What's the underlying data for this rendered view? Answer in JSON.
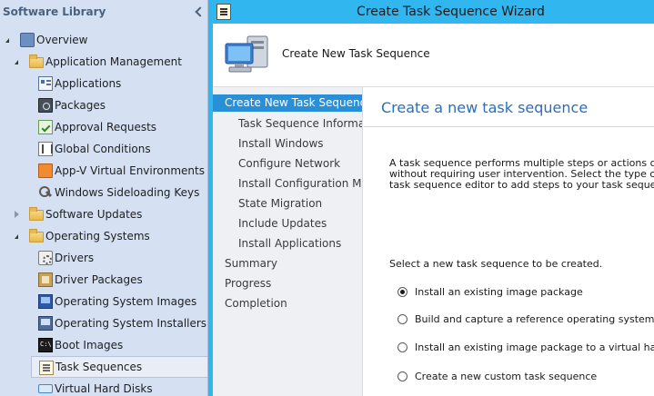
{
  "nav": {
    "header": "Software Library",
    "tree": [
      {
        "label": "Overview",
        "icon": "overview-icon",
        "level": 0,
        "expander": "open"
      },
      {
        "label": "Application Management",
        "icon": "folder-icon",
        "level": 1,
        "expander": "open"
      },
      {
        "label": "Applications",
        "icon": "applications-icon",
        "level": 2
      },
      {
        "label": "Packages",
        "icon": "packages-icon",
        "level": 2
      },
      {
        "label": "Approval Requests",
        "icon": "approval-requests-icon",
        "level": 2
      },
      {
        "label": "Global Conditions",
        "icon": "global-conditions-icon",
        "level": 2
      },
      {
        "label": "App-V Virtual Environments",
        "icon": "appv-icon",
        "level": 2
      },
      {
        "label": "Windows Sideloading Keys",
        "icon": "sideloading-keys-icon",
        "level": 2
      },
      {
        "label": "Software Updates",
        "icon": "folder-icon",
        "level": 1,
        "expander": "closed"
      },
      {
        "label": "Operating Systems",
        "icon": "folder-icon",
        "level": 1,
        "expander": "open"
      },
      {
        "label": "Drivers",
        "icon": "drivers-icon",
        "level": 2
      },
      {
        "label": "Driver Packages",
        "icon": "driver-packages-icon",
        "level": 2
      },
      {
        "label": "Operating System Images",
        "icon": "os-images-icon",
        "level": 2
      },
      {
        "label": "Operating System Installers",
        "icon": "os-installers-icon",
        "level": 2
      },
      {
        "label": "Boot Images",
        "icon": "boot-images-icon",
        "level": 2
      },
      {
        "label": "Task Sequences",
        "icon": "task-sequences-icon",
        "level": 2,
        "selected": true
      },
      {
        "label": "Virtual Hard Disks",
        "icon": "virtual-hard-disks-icon",
        "level": 2
      }
    ]
  },
  "wizard": {
    "title": "Create Task Sequence Wizard",
    "banner_title": "Create New Task Sequence",
    "steps": [
      {
        "label": "Create New Task Sequence",
        "indent": 0,
        "active": true
      },
      {
        "label": "Task Sequence Information",
        "indent": 1
      },
      {
        "label": "Install Windows",
        "indent": 1
      },
      {
        "label": "Configure Network",
        "indent": 1
      },
      {
        "label": "Install Configuration Manager",
        "indent": 1
      },
      {
        "label": "State Migration",
        "indent": 1
      },
      {
        "label": "Include Updates",
        "indent": 1
      },
      {
        "label": "Install Applications",
        "indent": 1
      },
      {
        "label": "Summary",
        "indent": 0
      },
      {
        "label": "Progress",
        "indent": 0
      },
      {
        "label": "Completion",
        "indent": 0
      }
    ],
    "content": {
      "title": "Create a new task sequence",
      "description_lines": [
        "A task sequence performs multiple steps or actions on a client computer",
        "without requiring user intervention. Select the type of task sequence. Use the",
        "task sequence editor to add steps to your task sequence."
      ],
      "select_prompt": "Select a new task sequence to be created.",
      "options": [
        {
          "label": "Install an existing image package",
          "checked": true
        },
        {
          "label": "Build and capture a reference operating system image",
          "checked": false
        },
        {
          "label": "Install an existing image package to a virtual hard disk",
          "checked": false
        },
        {
          "label": "Create a new custom task sequence",
          "checked": false
        }
      ]
    }
  },
  "colors": {
    "titlebar": "#31b6f0",
    "nav_background": "#d5e1f2",
    "active_step": "#2a8fd9",
    "content_title": "#2a6ebd"
  }
}
